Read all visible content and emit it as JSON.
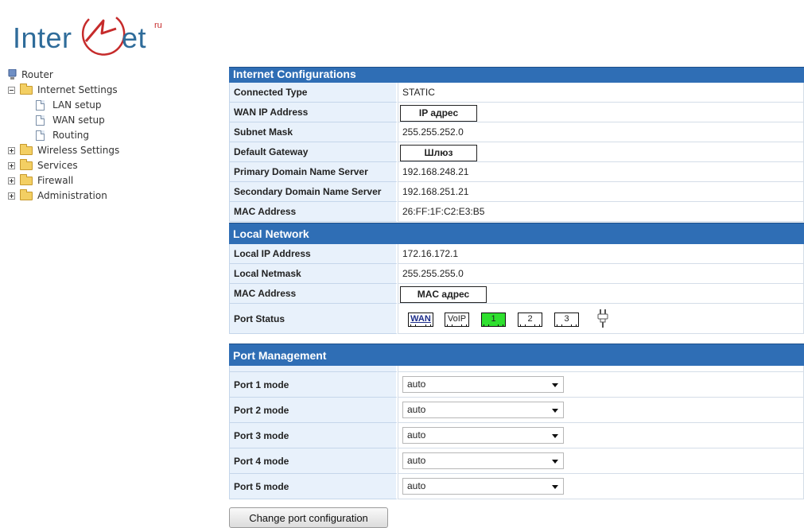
{
  "logo": {
    "left": "Inter",
    "right": "et",
    "sup": "ru"
  },
  "sidebar": {
    "root": "Router",
    "items": [
      {
        "label": "Internet Settings",
        "expanded": true,
        "children": [
          {
            "label": "LAN setup"
          },
          {
            "label": "WAN setup"
          },
          {
            "label": "Routing"
          }
        ]
      },
      {
        "label": "Wireless Settings",
        "expanded": false
      },
      {
        "label": "Services",
        "expanded": false
      },
      {
        "label": "Firewall",
        "expanded": false
      },
      {
        "label": "Administration",
        "expanded": false
      }
    ]
  },
  "internet": {
    "title": "Internet Configurations",
    "rows": [
      {
        "label": "Connected Type",
        "value": "STATIC"
      },
      {
        "label": "WAN IP Address",
        "value": "IP адрес"
      },
      {
        "label": "Subnet Mask",
        "value": "255.255.252.0"
      },
      {
        "label": "Default Gateway",
        "value": "Шлюз"
      },
      {
        "label": "Primary Domain Name Server",
        "value": "192.168.248.21"
      },
      {
        "label": "Secondary Domain Name Server",
        "value": "192.168.251.21"
      },
      {
        "label": "MAC Address",
        "value": "26:FF:1F:C2:E3:B5"
      }
    ]
  },
  "local": {
    "title": "Local Network",
    "rows": [
      {
        "label": "Local IP Address",
        "value": "172.16.172.1"
      },
      {
        "label": "Local Netmask",
        "value": "255.255.255.0"
      },
      {
        "label": "MAC Address",
        "value": "MAC адрес"
      }
    ],
    "port_status_label": "Port Status",
    "ports": [
      {
        "label": "WAN",
        "active": false
      },
      {
        "label": "VoIP",
        "active": false
      },
      {
        "label": "1",
        "active": true
      },
      {
        "label": "2",
        "active": false
      },
      {
        "label": "3",
        "active": false
      }
    ],
    "colors": {
      "active_port": "#2fe02f",
      "header": "#2f6eb5"
    }
  },
  "port_management": {
    "title": "Port Management",
    "rows": [
      {
        "label": "Port 1 mode",
        "value": "auto"
      },
      {
        "label": "Port 2 mode",
        "value": "auto"
      },
      {
        "label": "Port 3 mode",
        "value": "auto"
      },
      {
        "label": "Port 4 mode",
        "value": "auto"
      },
      {
        "label": "Port 5 mode",
        "value": "auto"
      }
    ],
    "button": "Change port configuration"
  }
}
